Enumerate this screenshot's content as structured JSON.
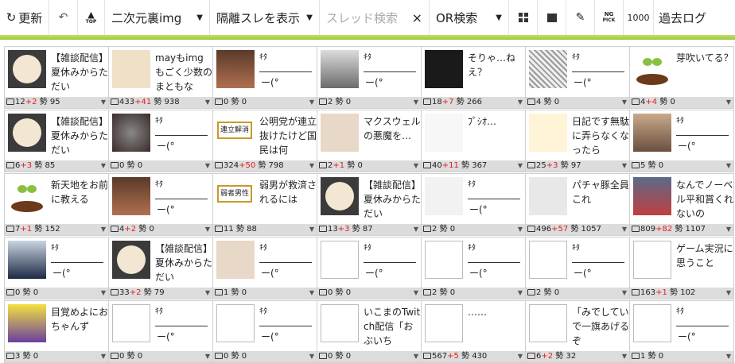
{
  "toolbar": {
    "refresh_label": "更新",
    "back_icon": "undo-arrow-icon",
    "top_label": "TOP",
    "board_label": "二次元裏img",
    "isolated_label": "隔離スレを表示",
    "search_placeholder": "スレッド検索",
    "clear_label": "×",
    "or_label": "OR検索",
    "ng_label_1": "NG",
    "ng_label_2": "PICK",
    "count_label": "1000",
    "past_log_label": "過去ログ"
  },
  "colors": {
    "accent_green": "#9dc63c",
    "red": "#e02020",
    "stat_bg": "#dcdcdc"
  },
  "cells": [
    {
      "thumb": "radio-logo",
      "text": "【雑談配信】夏休みからただい",
      "count": "12",
      "inc": "+2",
      "ikioi": "95"
    },
    {
      "thumb": "potato-illust",
      "text": "mayもimgもごく少数のまともな",
      "count": "433",
      "inc": "+41",
      "ikioi": "938"
    },
    {
      "thumb": "face-photo",
      "kita": true,
      "count": "0",
      "inc": "",
      "ikioi": "0"
    },
    {
      "thumb": "politician-photo",
      "kita": true,
      "count": "2",
      "inc": "",
      "ikioi": "0"
    },
    {
      "thumb": "tweet-screenshot",
      "text": "そりゃ…ねえ？",
      "count": "18",
      "inc": "+7",
      "ikioi": "266"
    },
    {
      "thumb": "manga-page",
      "kita": true,
      "count": "4",
      "inc": "",
      "ikioi": "0"
    },
    {
      "thumb": "sprout-image",
      "text": "芽吹いてる？",
      "count": "4",
      "inc": "+4",
      "ikioi": "0"
    },
    {
      "thumb": "radio-logo",
      "text": "【雑談配信】夏休みからただい",
      "count": "6",
      "inc": "+3",
      "ikioi": "85"
    },
    {
      "thumb": "dark-photo",
      "kita": true,
      "count": "0",
      "inc": "",
      "ikioi": "0"
    },
    {
      "thumb": "news-badge-1",
      "badge": "連立解消",
      "text": "公明党が連立抜けたけど国民は何",
      "count": "324",
      "inc": "+50",
      "ikioi": "798"
    },
    {
      "thumb": "anime-girl",
      "text": "マクスウェルの悪魔を…",
      "count": "2",
      "inc": "+1",
      "ikioi": "0"
    },
    {
      "thumb": "pink-rabbit",
      "text": "ﾌﾟｼｵ…",
      "count": "40",
      "inc": "+11",
      "ikioi": "367"
    },
    {
      "thumb": "manga-cats",
      "text": "日記です無駄に弄らなくなったら",
      "count": "25",
      "inc": "+3",
      "ikioi": "97"
    },
    {
      "thumb": "laughing-man",
      "kita": true,
      "count": "5",
      "inc": "",
      "ikioi": "0"
    },
    {
      "thumb": "sprout-image",
      "text": "新天地をお前に教える",
      "count": "7",
      "inc": "+1",
      "ikioi": "152"
    },
    {
      "thumb": "face-photo",
      "kita": true,
      "count": "4",
      "inc": "+2",
      "ikioi": "0"
    },
    {
      "thumb": "news-badge-2",
      "badge": "弱者男性",
      "text": "弱男が救済されるには",
      "count": "11",
      "inc": "",
      "ikioi": "88"
    },
    {
      "thumb": "radio-logo",
      "text": "【雑談配信】夏休みからただい",
      "count": "13",
      "inc": "+3",
      "ikioi": "87"
    },
    {
      "thumb": "white-rabbit",
      "kita": true,
      "count": "2",
      "inc": "",
      "ikioi": "0"
    },
    {
      "thumb": "manga-panel",
      "text": "パチャ豚全員これ",
      "count": "496",
      "inc": "+57",
      "ikioi": "1057"
    },
    {
      "thumb": "speaker-photo",
      "text": "なんでノーベル平和賞くれないの",
      "count": "809",
      "inc": "+82",
      "ikioi": "1107"
    },
    {
      "thumb": "suit-man",
      "kita": true,
      "count": "0",
      "inc": "",
      "ikioi": "0"
    },
    {
      "thumb": "radio-logo",
      "text": "【雑談配信】夏休みからただい",
      "count": "33",
      "inc": "+2",
      "ikioi": "79"
    },
    {
      "thumb": "anime-girl",
      "kita": true,
      "count": "1",
      "inc": "",
      "ikioi": "0"
    },
    {
      "thumb": "broken",
      "kita": true,
      "count": "0",
      "inc": "",
      "ikioi": "0"
    },
    {
      "thumb": "broken",
      "kita": true,
      "count": "2",
      "inc": "",
      "ikioi": "0"
    },
    {
      "thumb": "broken",
      "kita": true,
      "count": "2",
      "inc": "",
      "ikioi": "0"
    },
    {
      "thumb": "broken",
      "text": "ゲーム実況に思うこと",
      "count": "163",
      "inc": "+1",
      "ikioi": "102"
    },
    {
      "thumb": "anime-purple",
      "text": "目覚めよにおちゃんず",
      "count": "3",
      "inc": "",
      "ikioi": "0"
    },
    {
      "thumb": "broken",
      "kita": true,
      "count": "0",
      "inc": "",
      "ikioi": "0"
    },
    {
      "thumb": "broken",
      "kita": true,
      "count": "0",
      "inc": "",
      "ikioi": "0"
    },
    {
      "thumb": "broken",
      "text": "いこまのTwitch配信「おぶいち",
      "count": "0",
      "inc": "",
      "ikioi": "0"
    },
    {
      "thumb": "broken",
      "text": "……",
      "count": "567",
      "inc": "+5",
      "ikioi": "430"
    },
    {
      "thumb": "broken",
      "text": "「みでしていで一旗あげるぞ",
      "count": "6",
      "inc": "+2",
      "ikioi": "32"
    },
    {
      "thumb": "broken",
      "kita": true,
      "count": "1",
      "inc": "",
      "ikioi": "0"
    }
  ],
  "kita": {
    "l1": "ｷﾀ",
    "l3": "ー(°"
  },
  "ikioi_label": "勢"
}
